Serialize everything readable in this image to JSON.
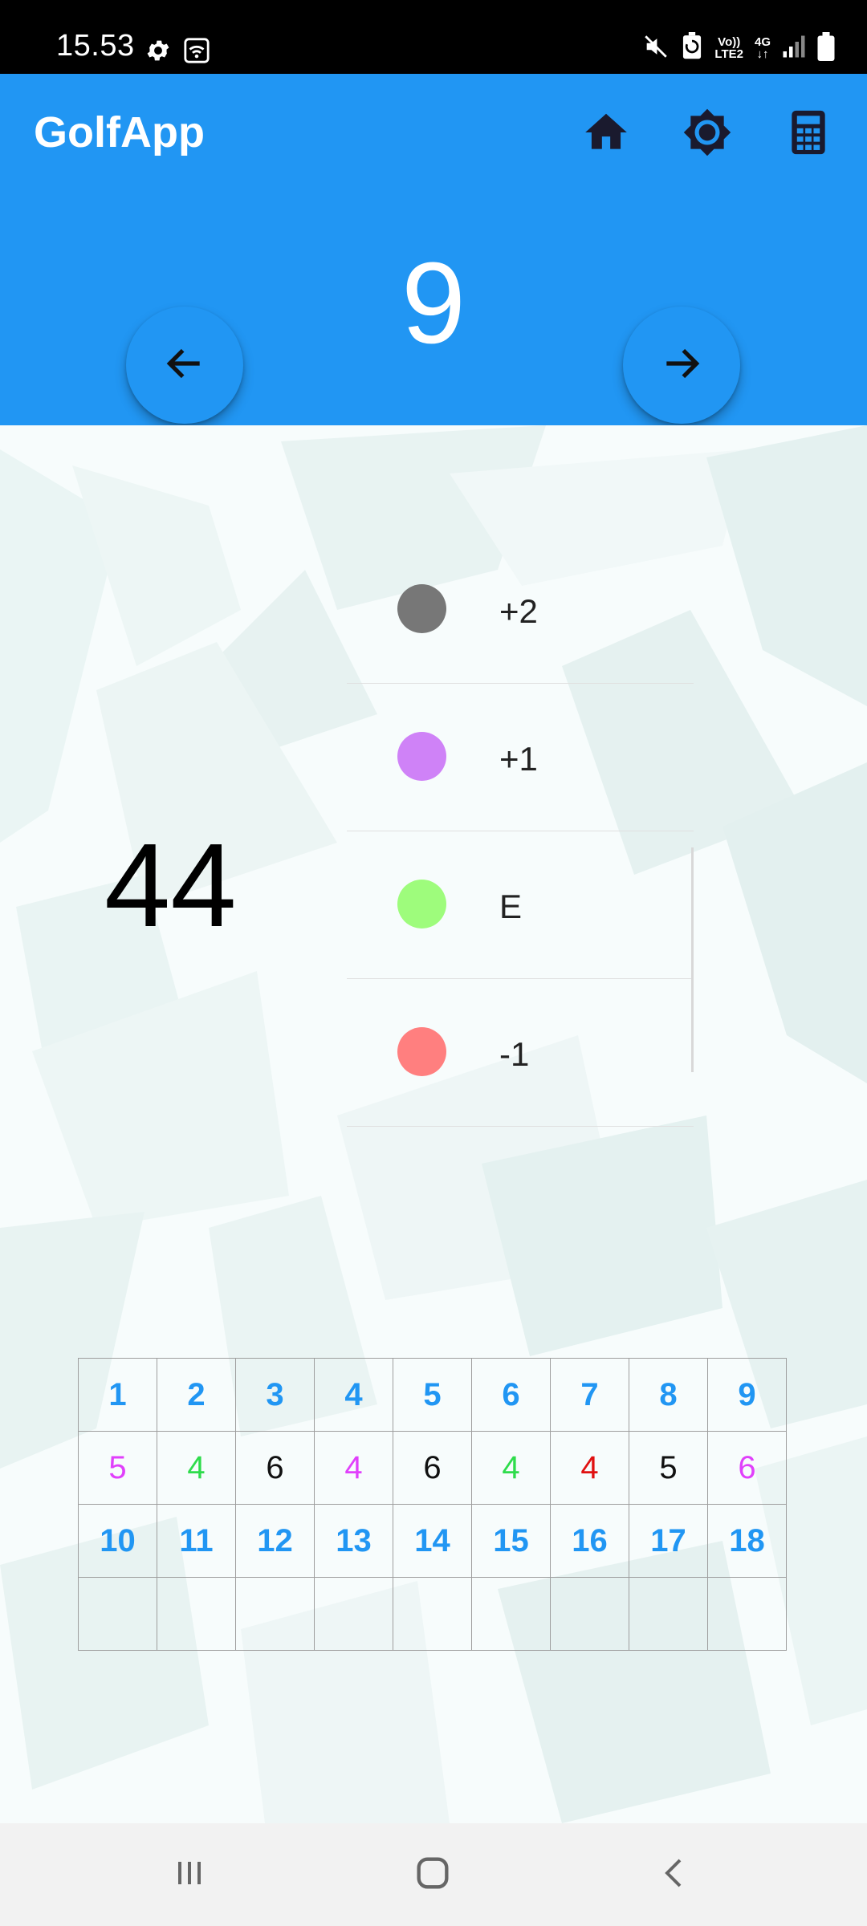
{
  "status_bar": {
    "time": "15.53",
    "network_line1": "Vo))",
    "network_line2": "LTE2",
    "data_type": "4G",
    "left_icons": [
      "gear-icon",
      "wifi-hotspot-icon"
    ],
    "right_icons": [
      "mute-icon",
      "battery-saver-icon",
      "signal-icon",
      "battery-icon"
    ]
  },
  "app_bar": {
    "title": "GolfApp",
    "icons": [
      "home-icon",
      "brightness-icon",
      "calculator-icon"
    ],
    "current_hole": "9",
    "prev_icon": "arrow-left-icon",
    "next_icon": "arrow-right-icon",
    "color": "#2196f3"
  },
  "main": {
    "total_score": "44",
    "score_options": [
      {
        "label": "+2",
        "color": "#777777"
      },
      {
        "label": "+1",
        "color": "#cf82f7"
      },
      {
        "label": "E",
        "color": "#9efc7c"
      },
      {
        "label": "-1",
        "color": "#ff7f7f"
      }
    ]
  },
  "scorecard": {
    "front_holes": [
      "1",
      "2",
      "3",
      "4",
      "5",
      "6",
      "7",
      "8",
      "9"
    ],
    "front_scores": [
      {
        "value": "5",
        "color": "#e040fb"
      },
      {
        "value": "4",
        "color": "#2edc4b"
      },
      {
        "value": "6",
        "color": "#111111"
      },
      {
        "value": "4",
        "color": "#e040fb"
      },
      {
        "value": "6",
        "color": "#111111"
      },
      {
        "value": "4",
        "color": "#2edc4b"
      },
      {
        "value": "4",
        "color": "#e01010"
      },
      {
        "value": "5",
        "color": "#111111"
      },
      {
        "value": "6",
        "color": "#e040fb"
      }
    ],
    "back_holes": [
      "10",
      "11",
      "12",
      "13",
      "14",
      "15",
      "16",
      "17",
      "18"
    ],
    "back_scores": [
      "",
      "",
      "",
      "",
      "",
      "",
      "",
      "",
      ""
    ],
    "hole_color": "#2196f3"
  },
  "system_nav": {
    "buttons": [
      "recents-icon",
      "home-circle-icon",
      "back-icon"
    ]
  }
}
